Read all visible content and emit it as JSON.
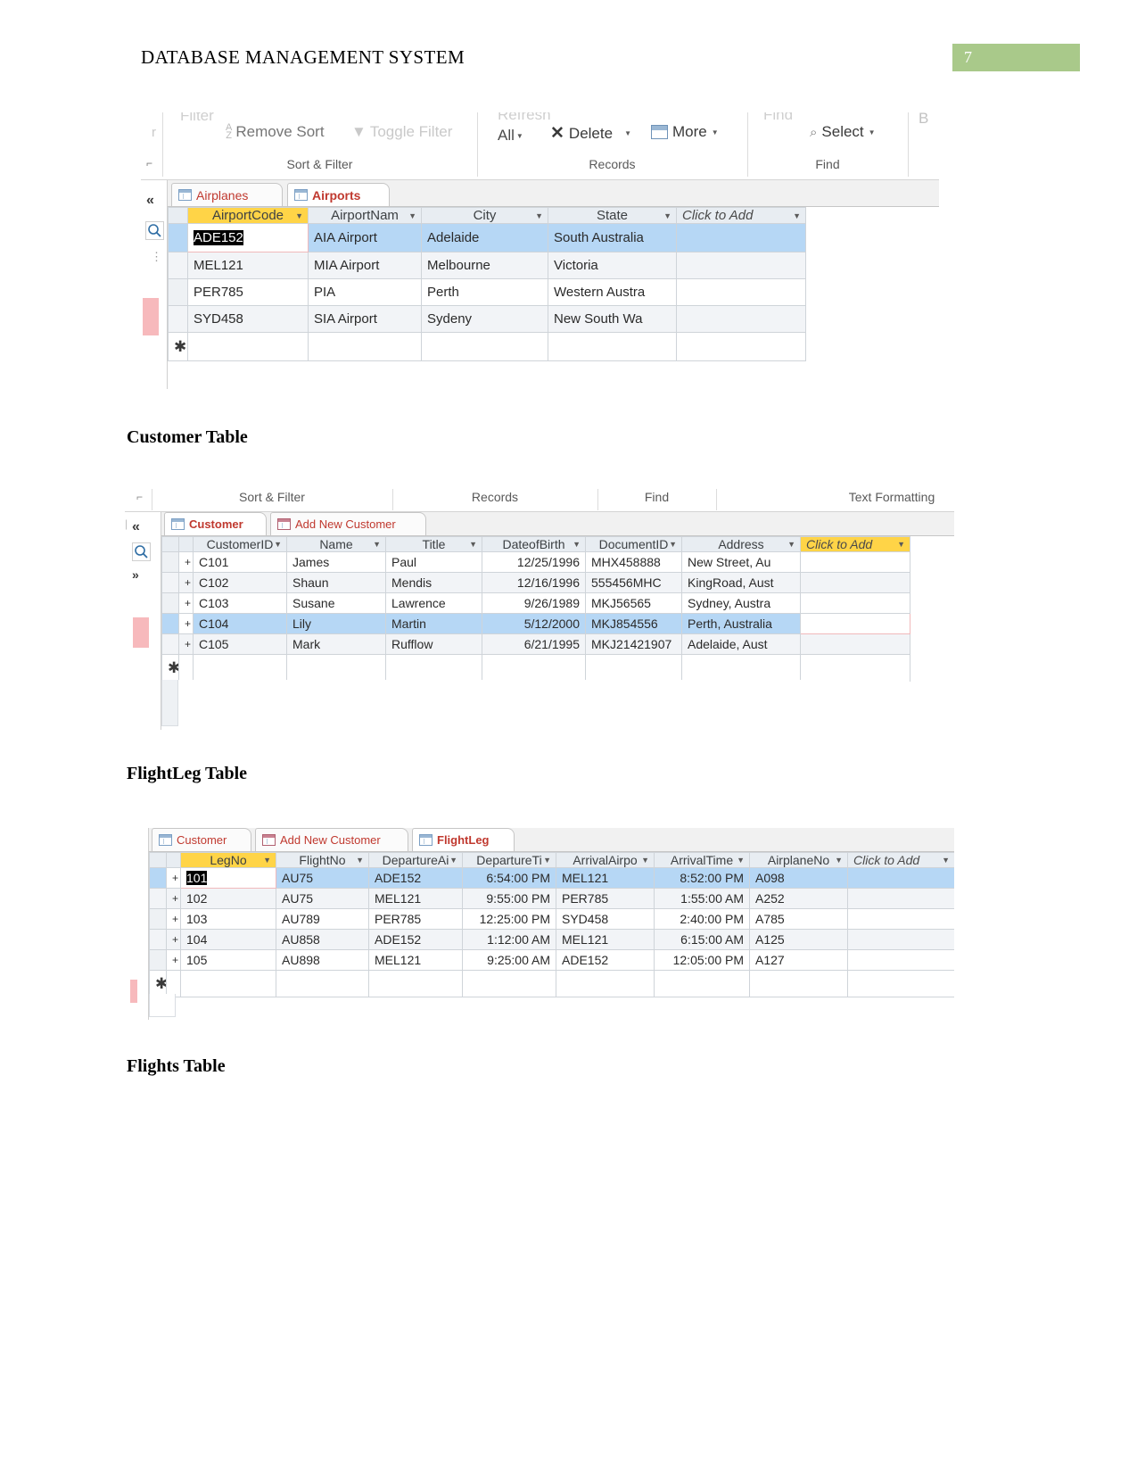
{
  "document": {
    "header_title": "DATABASE MANAGEMENT SYSTEM",
    "page_number": "7",
    "page_number_bg": "#a9c98a"
  },
  "headings": {
    "customer": "Customer Table",
    "flightleg": "FlightLeg Table",
    "flights": "Flights Table"
  },
  "airports_shot": {
    "ribbon": {
      "filter_clipped": "Filter",
      "remove_sort": "Remove Sort",
      "toggle_filter": "Toggle Filter",
      "refresh_clipped": "Refresh",
      "refresh_all": "All",
      "delete": "Delete",
      "more": "More",
      "find_clipped": "Find",
      "select": "Select",
      "b_letter": "B",
      "groups": {
        "sort_filter": "Sort & Filter",
        "records": "Records",
        "find": "Find"
      }
    },
    "tabs": [
      {
        "label": "Airplanes",
        "active": false,
        "icon": "table-icon"
      },
      {
        "label": "Airports",
        "active": true,
        "icon": "table-icon"
      }
    ],
    "grid": {
      "columns": [
        "AirportCode",
        "AirportNam",
        "City",
        "State",
        "Click to Add"
      ],
      "selected_column": "AirportCode",
      "rows": [
        {
          "AirportCode": "ADE152",
          "AirportName": "AIA Airport",
          "City": "Adelaide",
          "State": "South Australia",
          "selected": true,
          "editing": true
        },
        {
          "AirportCode": "MEL121",
          "AirportName": "MIA Airport",
          "City": "Melbourne",
          "State": "Victoria",
          "selected": false,
          "editing": false
        },
        {
          "AirportCode": "PER785",
          "AirportName": "PIA",
          "City": "Perth",
          "State": "Western Austra",
          "selected": false,
          "editing": false
        },
        {
          "AirportCode": "SYD458",
          "AirportName": "SIA Airport",
          "City": "Sydeny",
          "State": "New South Wa",
          "selected": false,
          "editing": false
        }
      ],
      "new_row_marker": "✱"
    },
    "nav": {
      "collapse": "«",
      "search_icon": "search-icon"
    }
  },
  "customer_shot": {
    "groups": {
      "sort_filter": "Sort & Filter",
      "records": "Records",
      "find": "Find",
      "text_formatting": "Text Formatting"
    },
    "tabs": [
      {
        "label": "Customer",
        "active": true,
        "icon": "table-icon"
      },
      {
        "label": "Add New Customer",
        "active": false,
        "icon": "form-icon"
      }
    ],
    "grid": {
      "columns": [
        "CustomerID",
        "Name",
        "Title",
        "DateofBirth",
        "DocumentID",
        "Address",
        "Click to Add"
      ],
      "rows": [
        {
          "CustomerID": "C101",
          "Name": "James",
          "Title": "Paul",
          "DateofBirth": "12/25/1996",
          "DocumentID": "MHX458888",
          "Address": "New Street, Au",
          "selected": false
        },
        {
          "CustomerID": "C102",
          "Name": "Shaun",
          "Title": "Mendis",
          "DateofBirth": "12/16/1996",
          "DocumentID": "555456MHC",
          "Address": "KingRoad, Aust",
          "selected": false
        },
        {
          "CustomerID": "C103",
          "Name": "Susane",
          "Title": "Lawrence",
          "DateofBirth": "9/26/1989",
          "DocumentID": "MKJ56565",
          "Address": "Sydney, Austra",
          "selected": false
        },
        {
          "CustomerID": "C104",
          "Name": "Lily",
          "Title": "Martin",
          "DateofBirth": "5/12/2000",
          "DocumentID": "MKJ854556",
          "Address": "Perth, Australia",
          "selected": true
        },
        {
          "CustomerID": "C105",
          "Name": "Mark",
          "Title": "Rufflow",
          "DateofBirth": "6/21/1995",
          "DocumentID": "MKJ21421907",
          "Address": "Adelaide, Aust",
          "selected": false
        }
      ],
      "new_row_marker": "✱",
      "expander": "+"
    },
    "nav": {
      "collapse": "«",
      "search_icon": "search-icon",
      "expand": "»"
    }
  },
  "flightleg_shot": {
    "tabs": [
      {
        "label": "Customer",
        "active": false,
        "icon": "table-icon"
      },
      {
        "label": "Add New Customer",
        "active": false,
        "icon": "form-icon"
      },
      {
        "label": "FlightLeg",
        "active": true,
        "icon": "table-icon"
      }
    ],
    "grid": {
      "columns": [
        "LegNo",
        "FlightNo",
        "DepartureAi",
        "DepartureTi",
        "ArrivalAirpo",
        "ArrivalTime",
        "AirplaneNo",
        "Click to Add"
      ],
      "selected_column": "LegNo",
      "rows": [
        {
          "LegNo": "101",
          "FlightNo": "AU75",
          "DepartureAirport": "ADE152",
          "DepartureTime": "6:54:00 PM",
          "ArrivalAirport": "MEL121",
          "ArrivalTime": "8:52:00 PM",
          "AirplaneNo": "A098",
          "selected": true,
          "editing": true
        },
        {
          "LegNo": "102",
          "FlightNo": "AU75",
          "DepartureAirport": "MEL121",
          "DepartureTime": "9:55:00 PM",
          "ArrivalAirport": "PER785",
          "ArrivalTime": "1:55:00 AM",
          "AirplaneNo": "A252",
          "selected": false,
          "editing": false
        },
        {
          "LegNo": "103",
          "FlightNo": "AU789",
          "DepartureAirport": "PER785",
          "DepartureTime": "12:25:00 PM",
          "ArrivalAirport": "SYD458",
          "ArrivalTime": "2:40:00 PM",
          "AirplaneNo": "A785",
          "selected": false,
          "editing": false
        },
        {
          "LegNo": "104",
          "FlightNo": "AU858",
          "DepartureAirport": "ADE152",
          "DepartureTime": "1:12:00 AM",
          "ArrivalAirport": "MEL121",
          "ArrivalTime": "6:15:00 AM",
          "AirplaneNo": "A125",
          "selected": false,
          "editing": false
        },
        {
          "LegNo": "105",
          "FlightNo": "AU898",
          "DepartureAirport": "MEL121",
          "DepartureTime": "9:25:00 AM",
          "ArrivalAirport": "ADE152",
          "ArrivalTime": "12:05:00 PM",
          "AirplaneNo": "A127",
          "selected": false,
          "editing": false
        }
      ],
      "new_row_marker": "✱",
      "expander": "+"
    }
  },
  "colors": {
    "selection_blue": "#b6d7f5",
    "header_gray": "#e8edf2",
    "current_yellow": "#ffd447",
    "tab_red": "#c0392f",
    "edit_pink": "#f0b9bb"
  }
}
